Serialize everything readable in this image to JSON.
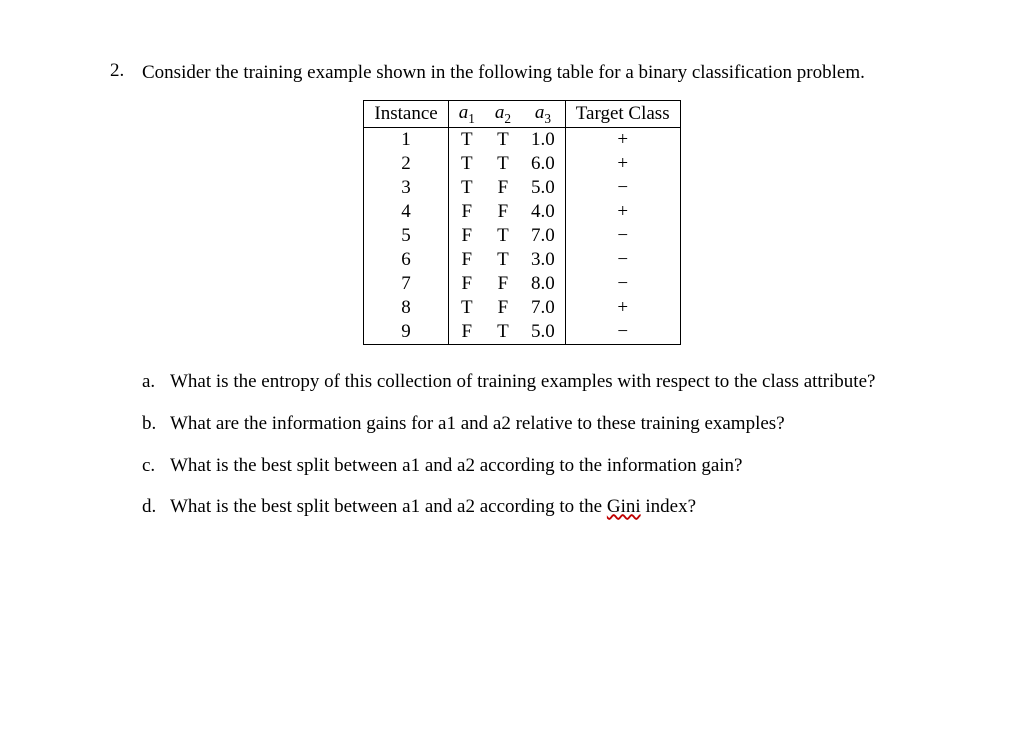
{
  "problem": {
    "number": "2.",
    "text": "Consider the training example shown in the following table for a binary classification problem."
  },
  "table": {
    "header": {
      "instance": "Instance",
      "a1_base": "a",
      "a1_sub": "1",
      "a2_base": "a",
      "a2_sub": "2",
      "a3_base": "a",
      "a3_sub": "3",
      "target": "Target Class"
    },
    "rows": [
      {
        "inst": "1",
        "a1": "T",
        "a2": "T",
        "a3": "1.0",
        "cls": "+"
      },
      {
        "inst": "2",
        "a1": "T",
        "a2": "T",
        "a3": "6.0",
        "cls": "+"
      },
      {
        "inst": "3",
        "a1": "T",
        "a2": "F",
        "a3": "5.0",
        "cls": "−"
      },
      {
        "inst": "4",
        "a1": "F",
        "a2": "F",
        "a3": "4.0",
        "cls": "+"
      },
      {
        "inst": "5",
        "a1": "F",
        "a2": "T",
        "a3": "7.0",
        "cls": "−"
      },
      {
        "inst": "6",
        "a1": "F",
        "a2": "T",
        "a3": "3.0",
        "cls": "−"
      },
      {
        "inst": "7",
        "a1": "F",
        "a2": "F",
        "a3": "8.0",
        "cls": "−"
      },
      {
        "inst": "8",
        "a1": "T",
        "a2": "F",
        "a3": "7.0",
        "cls": "+"
      },
      {
        "inst": "9",
        "a1": "F",
        "a2": "T",
        "a3": "5.0",
        "cls": "−"
      }
    ]
  },
  "subs": {
    "a": {
      "label": "a.",
      "text": "What is the entropy of this collection of training examples with respect to the class attribute?"
    },
    "b": {
      "label": "b.",
      "text": "What are the information gains for a1 and a2 relative to these training examples?"
    },
    "c": {
      "label": "c.",
      "text": "What is the best split between a1 and a2 according to the information gain?"
    },
    "d": {
      "label": "d.",
      "prefix": "What is the best split between a1 and a2 according to the ",
      "gini": "Gini",
      "suffix": " index?"
    }
  }
}
